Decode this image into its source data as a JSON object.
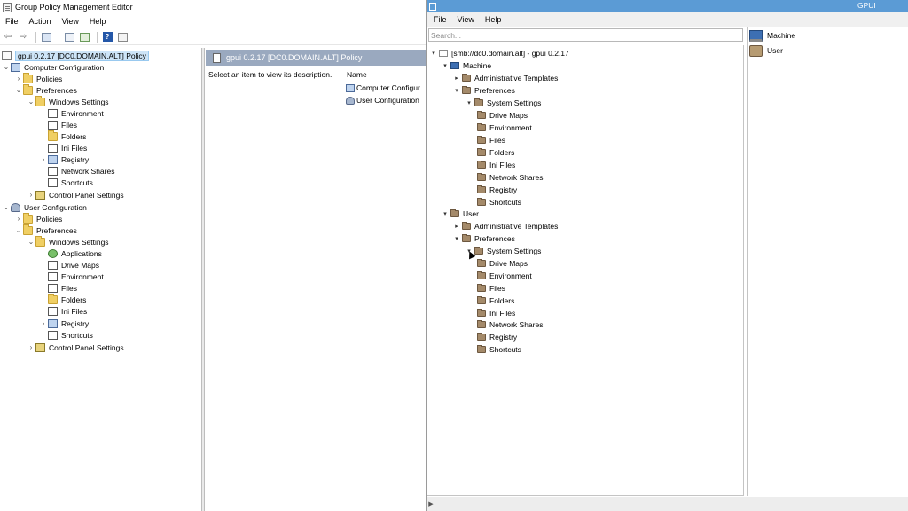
{
  "gpme": {
    "title": "Group Policy Management Editor",
    "menu": [
      "File",
      "Action",
      "View",
      "Help"
    ],
    "toolbar_icons": [
      "back-arrow-icon",
      "forward-arrow-icon",
      "show-hide-tree-icon",
      "properties-icon",
      "export-list-icon",
      "help-icon",
      "view-icon"
    ],
    "tree_root": "gpui 0.2.17 [DC0.DOMAIN.ALT] Policy",
    "computer_config": {
      "label": "Computer Configuration",
      "policies": "Policies",
      "preferences": "Preferences",
      "windows_settings": "Windows Settings",
      "items": [
        "Environment",
        "Files",
        "Folders",
        "Ini Files",
        "Registry",
        "Network Shares",
        "Shortcuts"
      ],
      "control_panel": "Control Panel Settings"
    },
    "user_config": {
      "label": "User Configuration",
      "policies": "Policies",
      "preferences": "Preferences",
      "windows_settings": "Windows Settings",
      "items": [
        "Applications",
        "Drive Maps",
        "Environment",
        "Files",
        "Folders",
        "Ini Files",
        "Registry",
        "Shortcuts"
      ],
      "control_panel": "Control Panel Settings"
    },
    "right_pane": {
      "header": "gpui 0.2.17 [DC0.DOMAIN.ALT] Policy",
      "description": "Select an item to view its description.",
      "name_column": "Name",
      "items": [
        "Computer Configur",
        "User Configuration"
      ]
    }
  },
  "gpui": {
    "title": "GPUI",
    "menu": [
      "File",
      "View",
      "Help"
    ],
    "search_placeholder": "Search...",
    "tree_root": "[smb://dc0.domain.alt] - gpui 0.2.17",
    "machine": {
      "label": "Machine",
      "admin_templates": "Administrative Templates",
      "preferences": "Preferences",
      "system_settings": "System Settings",
      "items": [
        "Drive Maps",
        "Environment",
        "Files",
        "Folders",
        "Ini Files",
        "Network Shares",
        "Registry",
        "Shortcuts"
      ]
    },
    "user": {
      "label": "User",
      "admin_templates": "Administrative Templates",
      "preferences": "Preferences",
      "system_settings": "System Settings",
      "items": [
        "Drive Maps",
        "Environment",
        "Files",
        "Folders",
        "Ini Files",
        "Network Shares",
        "Registry",
        "Shortcuts"
      ]
    },
    "list_items": [
      "Machine",
      "User"
    ]
  },
  "colors": {
    "gpui_titlebar": "#5b9bd5",
    "gpme_header": "#9aa9bf",
    "selection": "#cde4f7",
    "folder_yellow": "#f0cf64",
    "folder_brown": "#a48a6a"
  }
}
